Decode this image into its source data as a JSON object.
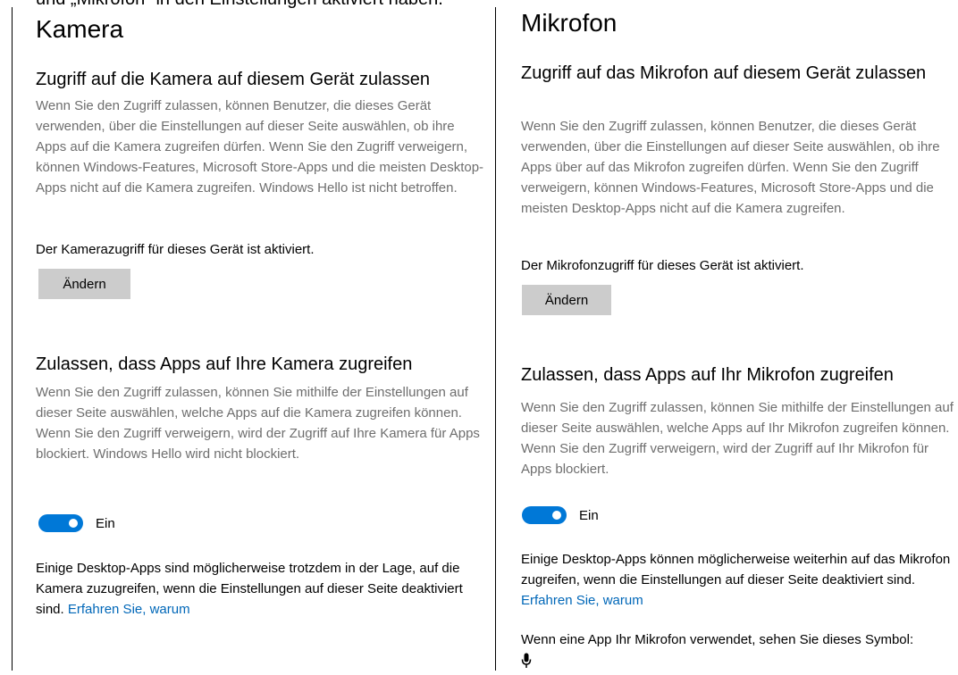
{
  "top_strip": {
    "text": "und „Mikrofon“ in den Einstellungen aktiviert haben."
  },
  "camera": {
    "page_title": "Kamera",
    "device_section": {
      "title": "Zugriff auf die Kamera auf diesem Gerät zulassen",
      "description": "Wenn Sie den Zugriff zulassen, können Benutzer, die dieses Gerät verwenden, über die Einstellungen auf dieser Seite auswählen, ob ihre Apps auf die Kamera zugreifen dürfen. Wenn Sie den Zugriff verweigern, können Windows-Features, Microsoft Store-Apps und die meisten Desktop-Apps nicht auf die Kamera zugreifen. Windows Hello ist nicht betroffen.",
      "status": "Der Kamerazugriff für dieses Gerät ist aktiviert.",
      "change_button": "Ändern"
    },
    "apps_section": {
      "title": "Zulassen, dass Apps auf Ihre Kamera zugreifen",
      "description": "Wenn Sie den Zugriff zulassen, können Sie mithilfe der Einstellungen auf dieser Seite auswählen, welche Apps auf die Kamera zugreifen können. Wenn Sie den Zugriff verweigern, wird der Zugriff auf Ihre Kamera für Apps blockiert. Windows Hello wird nicht blockiert.",
      "toggle_label": "Ein",
      "toggle_on": true,
      "note": "Einige Desktop-Apps sind möglicherweise trotzdem in der Lage, auf die Kamera zuzugreifen, wenn die Einstellungen auf dieser Seite deaktiviert sind.",
      "link": "Erfahren Sie, warum"
    }
  },
  "microphone": {
    "page_title": "Mikrofon",
    "device_section": {
      "title": "Zugriff auf das Mikrofon auf diesem Gerät zulassen",
      "description": "Wenn Sie den Zugriff zulassen, können Benutzer, die dieses Gerät verwenden, über die Einstellungen auf dieser Seite auswählen, ob ihre Apps über auf das Mikrofon zugreifen dürfen. Wenn Sie den Zugriff verweigern, können Windows-Features, Microsoft Store-Apps und die meisten Desktop-Apps nicht auf die Kamera zugreifen.",
      "status": "Der Mikrofonzugriff für dieses Gerät ist aktiviert.",
      "change_button": "Ändern"
    },
    "apps_section": {
      "title": "Zulassen, dass Apps auf Ihr Mikrofon zugreifen",
      "description": "Wenn Sie den Zugriff zulassen, können Sie mithilfe der Einstellungen auf dieser Seite auswählen, welche Apps auf Ihr Mikrofon zugreifen können. Wenn Sie den Zugriff verweigern, wird der Zugriff auf Ihr Mikrofon für Apps blockiert.",
      "toggle_label": "Ein",
      "toggle_on": true,
      "note": "Einige Desktop-Apps können möglicherweise weiterhin auf das Mikrofon zugreifen, wenn die Einstellungen auf dieser Seite deaktiviert sind.",
      "link": "Erfahren Sie, warum",
      "symbol_note": "Wenn eine App Ihr Mikrofon verwendet, sehen Sie dieses Symbol:",
      "symbol_icon": "microphone-icon"
    }
  },
  "colors": {
    "accent": "#0078d7",
    "link": "#0067b8",
    "description_text": "#6e6e6e",
    "button_bg": "#cccccc"
  }
}
